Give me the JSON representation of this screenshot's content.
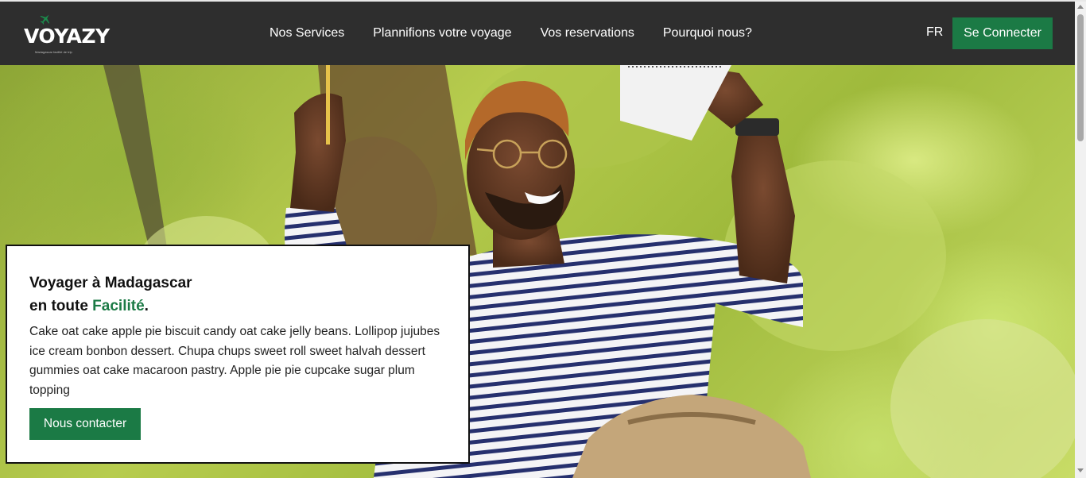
{
  "brand": {
    "name": "VOYAZY",
    "tagline": "Madagascar facilité de trip",
    "plane_icon": "plane-icon",
    "accent_color": "#1b7a45"
  },
  "nav": {
    "links": [
      "Nos Services",
      "Plannifions votre voyage",
      "Vos reservations",
      "Pourquoi nous?"
    ],
    "language": "FR",
    "login_label": "Se Connecter"
  },
  "hero": {
    "image": "smiling man in striped shirt with glasses holding notebook and pencil, green trees background",
    "card": {
      "title_line1": "Voyager à Madagascar",
      "title_line2_prefix": "en toute",
      "title_line2_highlight": "Facilité",
      "title_line2_suffix": ".",
      "body": "Cake oat cake apple pie biscuit candy oat cake jelly beans. Lollipop jujubes ice cream bonbon dessert. Chupa chups sweet roll sweet halvah dessert gummies oat cake macaroon pastry. Apple pie pie cupcake sugar plum topping",
      "button_label": "Nous contacter"
    }
  }
}
